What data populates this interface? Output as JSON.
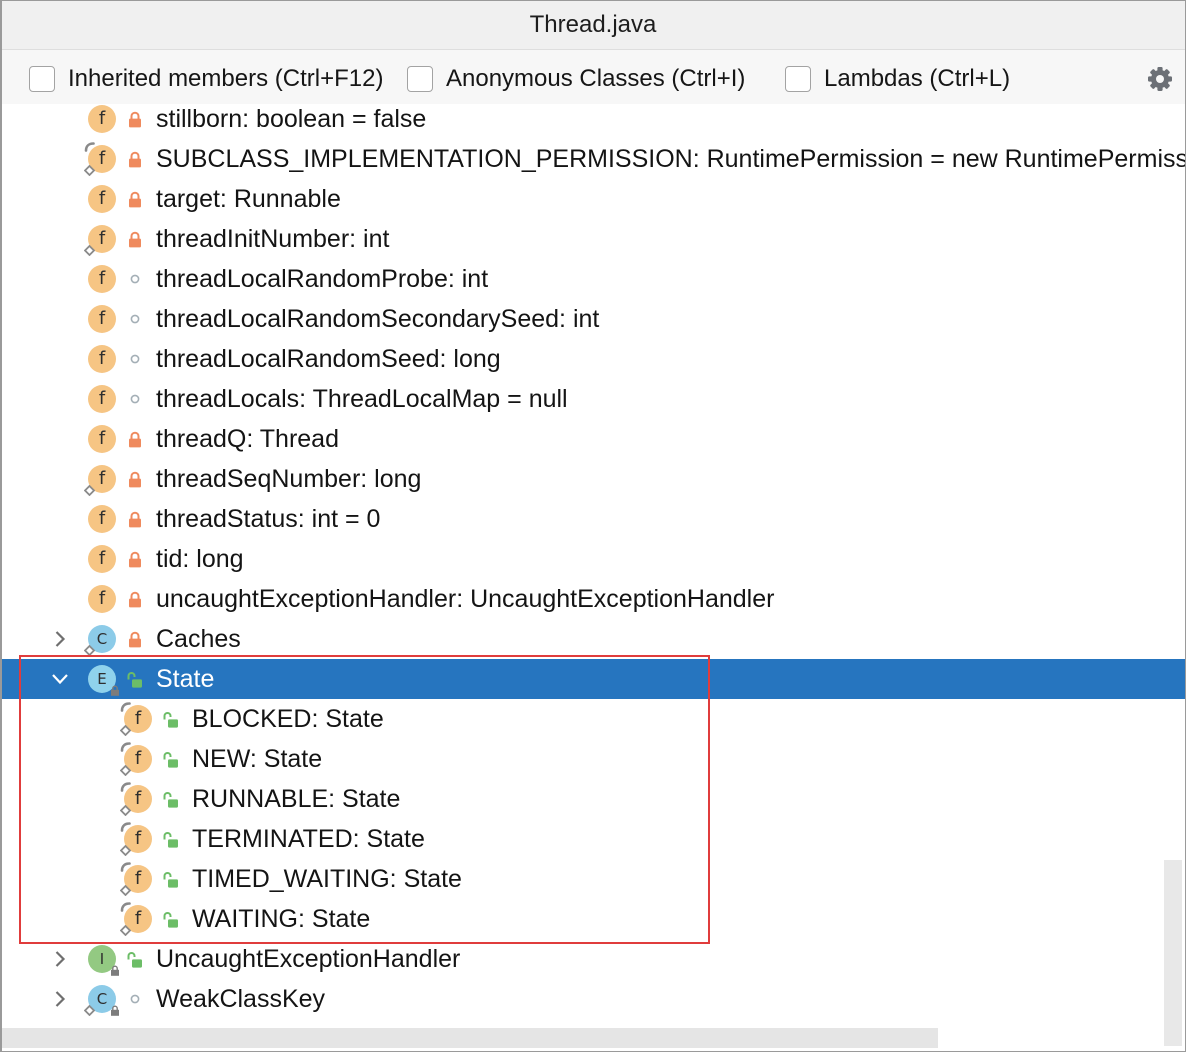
{
  "window": {
    "title": "Thread.java"
  },
  "toolbar": {
    "options": [
      {
        "label": "Inherited members (Ctrl+F12)",
        "checked": false
      },
      {
        "label": "Anonymous Classes (Ctrl+I)",
        "checked": false
      },
      {
        "label": "Lambdas (Ctrl+L)",
        "checked": false
      }
    ],
    "settings_icon": "gear-icon"
  },
  "icons": {
    "field": {
      "name": "field-icon",
      "letter": "f",
      "color": "#f6c584"
    },
    "class": {
      "name": "class-icon",
      "letter": "C",
      "color": "#8ccbe8"
    },
    "enum": {
      "name": "enum-icon",
      "letter": "E",
      "color": "#8fd2ec"
    },
    "interface": {
      "name": "interface-icon",
      "letter": "I",
      "color": "#93c982"
    }
  },
  "colors": {
    "selection": "#2675bf",
    "selection_text": "#ffffff",
    "annotation": "#e03c3c",
    "private": "#ef8a5d",
    "public": "#6cbd67",
    "package": "#a4afb6"
  },
  "tree": {
    "items": [
      {
        "label": "stillborn: boolean = false",
        "icon": "field",
        "access": "private",
        "marks": []
      },
      {
        "label": "SUBCLASS_IMPLEMENTATION_PERMISSION: RuntimePermission = new RuntimePermission",
        "icon": "field",
        "access": "private",
        "marks": [
          "final",
          "static"
        ]
      },
      {
        "label": "target: Runnable",
        "icon": "field",
        "access": "private",
        "marks": []
      },
      {
        "label": "threadInitNumber: int",
        "icon": "field",
        "access": "private",
        "marks": [
          "static"
        ]
      },
      {
        "label": "threadLocalRandomProbe: int",
        "icon": "field",
        "access": "package",
        "marks": []
      },
      {
        "label": "threadLocalRandomSecondarySeed: int",
        "icon": "field",
        "access": "package",
        "marks": []
      },
      {
        "label": "threadLocalRandomSeed: long",
        "icon": "field",
        "access": "package",
        "marks": []
      },
      {
        "label": "threadLocals: ThreadLocalMap = null",
        "icon": "field",
        "access": "package",
        "marks": []
      },
      {
        "label": "threadQ: Thread",
        "icon": "field",
        "access": "private",
        "marks": []
      },
      {
        "label": "threadSeqNumber: long",
        "icon": "field",
        "access": "private",
        "marks": [
          "static"
        ]
      },
      {
        "label": "threadStatus: int = 0",
        "icon": "field",
        "access": "private",
        "marks": []
      },
      {
        "label": "tid: long",
        "icon": "field",
        "access": "private",
        "marks": []
      },
      {
        "label": "uncaughtExceptionHandler: UncaughtExceptionHandler",
        "icon": "field",
        "access": "private",
        "marks": []
      },
      {
        "label": "Caches",
        "icon": "class",
        "access": "private",
        "marks": [
          "static"
        ],
        "expandable": true,
        "expanded": false
      },
      {
        "label": "State",
        "icon": "enum",
        "access": "public",
        "marks": [
          "locked"
        ],
        "expandable": true,
        "expanded": true,
        "selected": true,
        "children": [
          {
            "label": "BLOCKED: State",
            "icon": "field",
            "access": "public",
            "marks": [
              "final",
              "static"
            ]
          },
          {
            "label": "NEW: State",
            "icon": "field",
            "access": "public",
            "marks": [
              "final",
              "static"
            ]
          },
          {
            "label": "RUNNABLE: State",
            "icon": "field",
            "access": "public",
            "marks": [
              "final",
              "static"
            ]
          },
          {
            "label": "TERMINATED: State",
            "icon": "field",
            "access": "public",
            "marks": [
              "final",
              "static"
            ]
          },
          {
            "label": "TIMED_WAITING: State",
            "icon": "field",
            "access": "public",
            "marks": [
              "final",
              "static"
            ]
          },
          {
            "label": "WAITING: State",
            "icon": "field",
            "access": "public",
            "marks": [
              "final",
              "static"
            ]
          }
        ]
      },
      {
        "label": "UncaughtExceptionHandler",
        "icon": "interface",
        "access": "public",
        "marks": [
          "locked"
        ],
        "expandable": true,
        "expanded": false
      },
      {
        "label": "WeakClassKey",
        "icon": "class",
        "access": "package",
        "marks": [
          "static",
          "locked"
        ],
        "expandable": true,
        "expanded": false
      }
    ]
  }
}
